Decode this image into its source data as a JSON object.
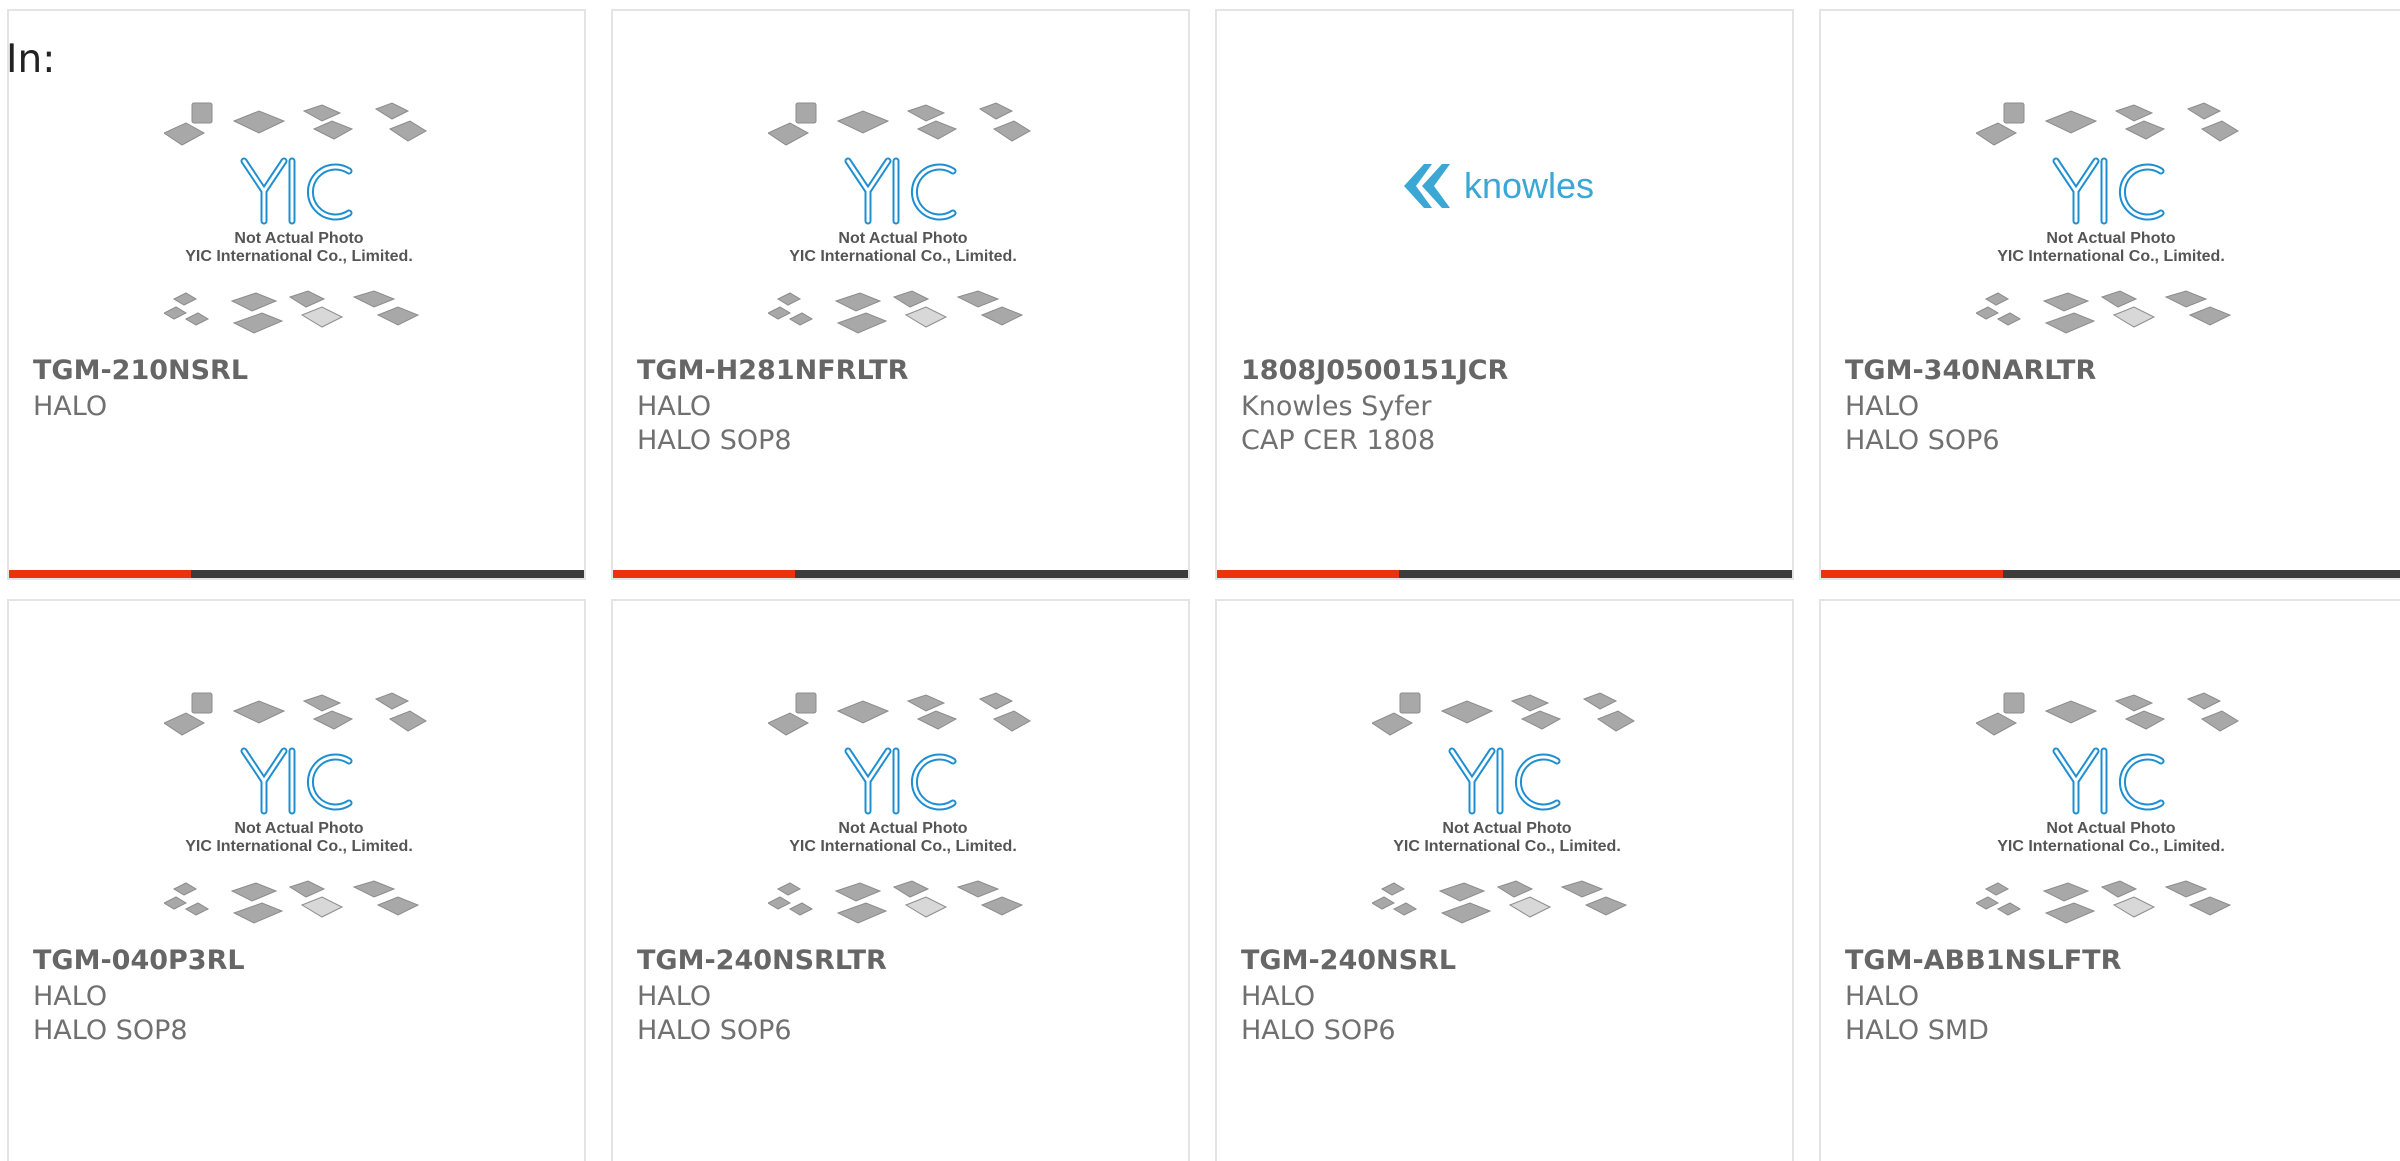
{
  "header": {
    "label": "In:"
  },
  "placeholder_image": {
    "line1": "Not Actual Photo",
    "line2": "YIC International Co., Limited.",
    "logo_text": "YIC"
  },
  "knowles_logo_text": "knowles",
  "colors": {
    "accent": "#e8330e",
    "bar": "#3c3c3c",
    "yic_blue": "#1f8fd0",
    "knowles_blue": "#3aa7d4"
  },
  "products": [
    {
      "part": "TGM-210NSRL",
      "manufacturer": "HALO",
      "package": "",
      "image": "yic-placeholder"
    },
    {
      "part": "TGM-H281NFRLTR",
      "manufacturer": "HALO",
      "package": "HALO SOP8",
      "image": "yic-placeholder"
    },
    {
      "part": "1808J0500151JCR",
      "manufacturer": "Knowles Syfer",
      "package": "CAP CER 1808",
      "image": "knowles-logo"
    },
    {
      "part": "TGM-340NARLTR",
      "manufacturer": "HALO",
      "package": "HALO SOP6",
      "image": "yic-placeholder"
    },
    {
      "part": "TGM-040P3RL",
      "manufacturer": "HALO",
      "package": "HALO SOP8",
      "image": "yic-placeholder"
    },
    {
      "part": "TGM-240NSRLTR",
      "manufacturer": "HALO",
      "package": "HALO SOP6",
      "image": "yic-placeholder"
    },
    {
      "part": "TGM-240NSRL",
      "manufacturer": "HALO",
      "package": "HALO SOP6",
      "image": "yic-placeholder"
    },
    {
      "part": "TGM-ABB1NSLFTR",
      "manufacturer": "HALO",
      "package": "HALO SMD",
      "image": "yic-placeholder"
    }
  ]
}
